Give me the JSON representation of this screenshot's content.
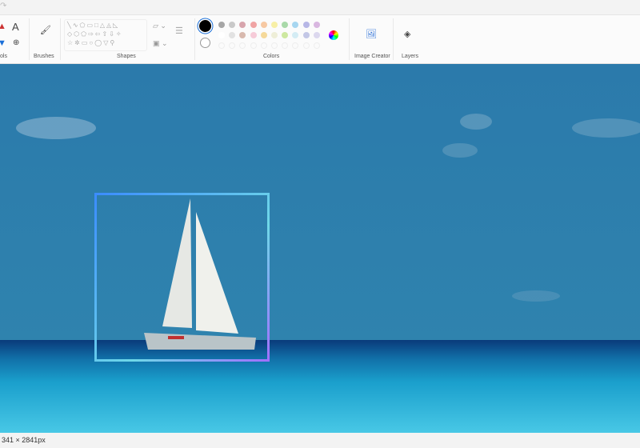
{
  "ribbon": {
    "groups": {
      "tools": "ols",
      "brushes": "Brushes",
      "shapes": "Shapes",
      "colors": "Colors",
      "image_creator": "Image Creator",
      "layers": "Layers"
    },
    "text_tool": "A",
    "colors": {
      "primary": "#000000",
      "secondary": "#ffffff",
      "row1": [
        "#a6a6a6",
        "#c9c9c9",
        "#d8a5ad",
        "#f0a4a4",
        "#f7c9a3",
        "#f7efa6",
        "#a9d9a9",
        "#a7d6f0",
        "#b7b7e6",
        "#d9b7e0"
      ],
      "row2": [
        "#ffffff",
        "#e2e2e2",
        "#d8b9ae",
        "#f6cbd8",
        "#f5d99a",
        "#eeeed8",
        "#cde8a0",
        "#d4ecf4",
        "#c3c7e6",
        "#dcd8ee"
      ]
    }
  },
  "status": {
    "dimensions": "341 × 2841px"
  }
}
